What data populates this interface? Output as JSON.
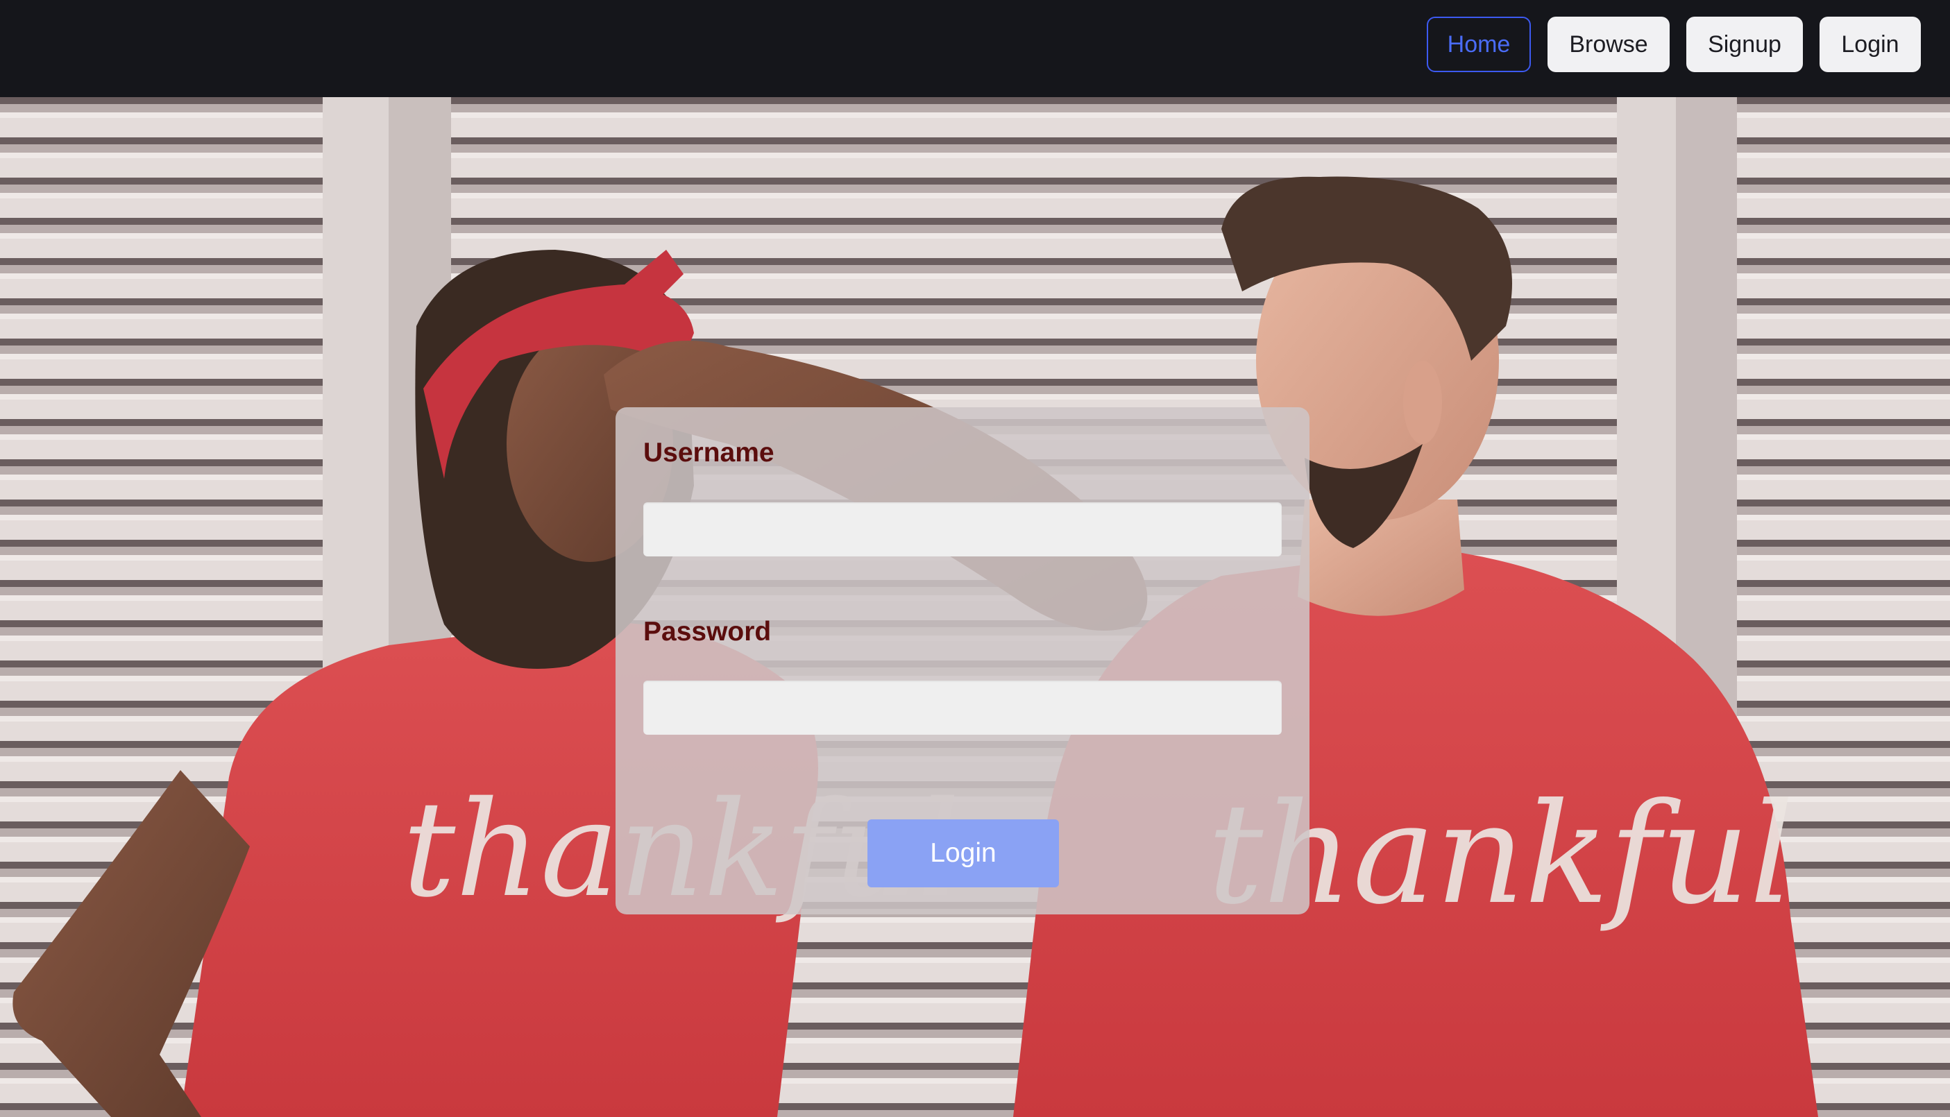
{
  "nav": {
    "items": [
      {
        "label": "Home",
        "active": true
      },
      {
        "label": "Browse",
        "active": false
      },
      {
        "label": "Signup",
        "active": false
      },
      {
        "label": "Login",
        "active": false
      }
    ]
  },
  "background": {
    "subject": "two people in red t-shirts in front of white shutters",
    "shirt_print": "thankful"
  },
  "form": {
    "username_label": "Username",
    "username_value": "",
    "password_label": "Password",
    "password_value": "",
    "submit_label": "Login"
  },
  "colors": {
    "navbar_bg": "#15161b",
    "active_nav_border": "#3d5af1",
    "label_text": "#5b0d0d",
    "submit_bg": "#8aa2f4",
    "shirt_red": "#d9464a"
  }
}
